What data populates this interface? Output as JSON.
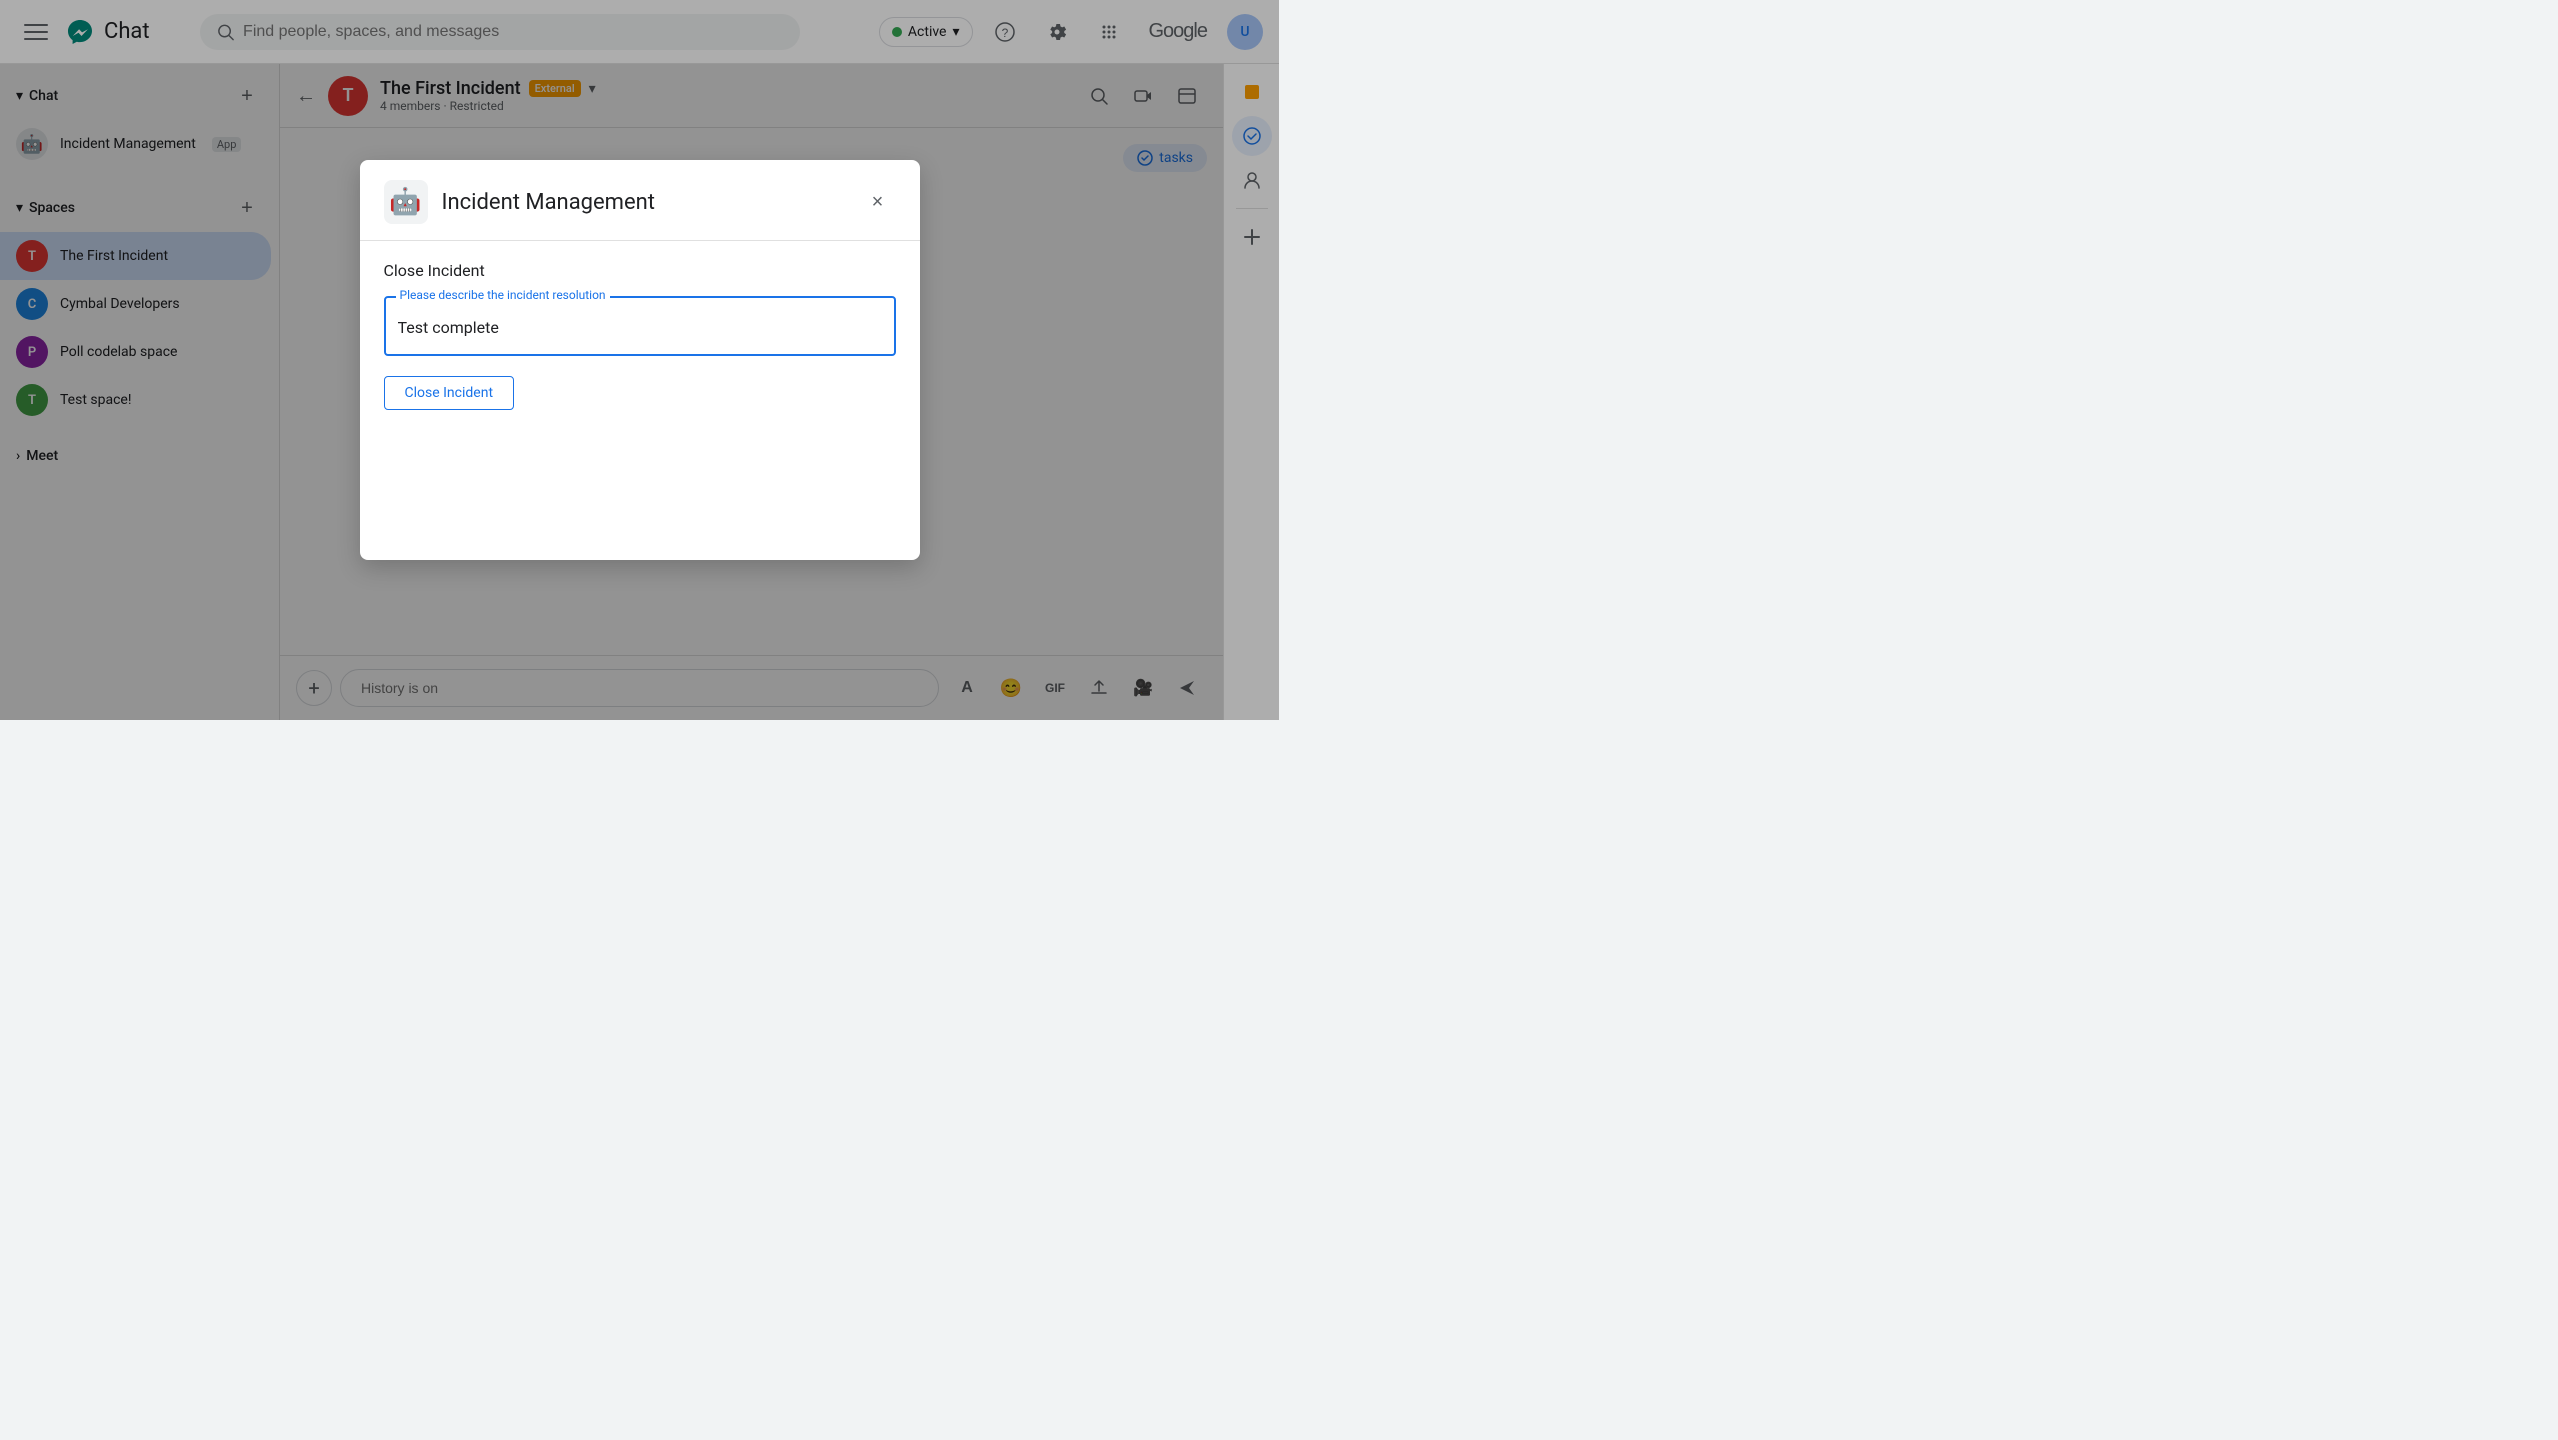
{
  "app": {
    "title": "Chat"
  },
  "topbar": {
    "hamburger_label": "Menu",
    "search_placeholder": "Find people, spaces, and messages",
    "status": "Active",
    "google_label": "Google"
  },
  "sidebar": {
    "chat_label": "Chat",
    "add_label": "+",
    "direct_messages": [
      {
        "id": "incident-management",
        "label": "Incident Management",
        "badge": "App",
        "avatar_color": "#80868b",
        "avatar_letter": "🤖"
      }
    ],
    "spaces_label": "Spaces",
    "spaces": [
      {
        "id": "the-first-incident",
        "label": "The First Incident",
        "avatar_color": "#e53935",
        "avatar_letter": "T",
        "active": true
      },
      {
        "id": "cymbal-developers",
        "label": "Cymbal Developers",
        "avatar_color": "#1e88e5",
        "avatar_letter": "C",
        "active": false
      },
      {
        "id": "poll-codelab-space",
        "label": "Poll codelab space",
        "avatar_color": "#8e24aa",
        "avatar_letter": "P",
        "active": false
      },
      {
        "id": "test-space",
        "label": "Test space!",
        "avatar_color": "#43a047",
        "avatar_letter": "T",
        "active": false
      }
    ],
    "meet_label": "Meet"
  },
  "chat_header": {
    "title": "The First Incident",
    "external_badge": "External",
    "subtitle": "4 members · Restricted",
    "back_label": "←"
  },
  "input_bar": {
    "placeholder": "History is on"
  },
  "modal": {
    "title": "Incident Management",
    "close_label": "×",
    "form_label": "Close Incident",
    "field_label": "Please describe the incident resolution",
    "field_value": "Test complete",
    "submit_label": "Close Incident"
  },
  "right_panel": {
    "tasks_label": "tasks"
  },
  "icons": {
    "search": "🔍",
    "settings": "⚙",
    "apps": "⋮⋮⋮",
    "help": "?",
    "back": "←",
    "close": "×",
    "add": "+",
    "send": "➤",
    "emoji": "😊",
    "gif": "GIF",
    "upload": "⬆",
    "video": "🎥",
    "format": "A",
    "people": "👤",
    "task_check": "✓",
    "chevron_down": "▾",
    "chevron_right": "›"
  }
}
